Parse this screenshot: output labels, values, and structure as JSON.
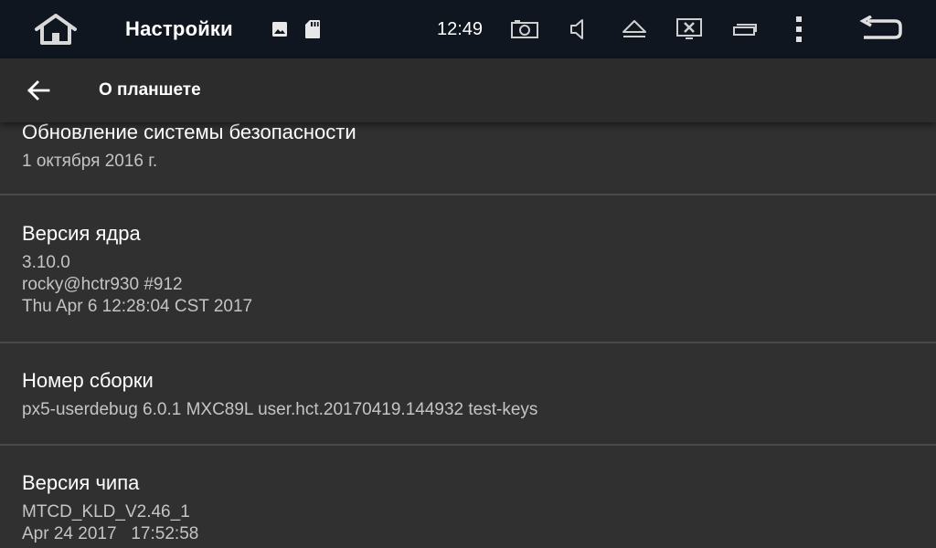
{
  "statusbar": {
    "title": "Настройки",
    "time": "12:49",
    "icons": [
      "home-icon",
      "gallery-icon",
      "sd-card-icon",
      "screenshot-icon",
      "volume-icon",
      "eject-icon",
      "close-screen-icon",
      "windows-icon",
      "more-vert-icon",
      "back-icon"
    ]
  },
  "toolbar": {
    "title": "О планшете",
    "back_icon": "arrow-back-icon"
  },
  "preferences": [
    {
      "title": "Обновление системы безопасности",
      "summary": "1 октября 2016 г."
    },
    {
      "title": "Версия ядра",
      "summary": "3.10.0\nrocky@hctr930 #912\nThu Apr 6 12:28:04 CST 2017"
    },
    {
      "title": "Номер сборки",
      "summary": "px5-userdebug 6.0.1 MXC89L user.hct.20170419.144932 test-keys"
    },
    {
      "title": "Версия чипа",
      "summary": "MTCD_KLD_V2.46_1\nApr 24 2017   17:52:58"
    }
  ],
  "colors": {
    "statusbar_bg": "#0f1620",
    "toolbar_bg": "#2c2c2c",
    "content_bg": "#303030",
    "divider": "#4a4a4a",
    "summary_text": "#c4c4c4"
  }
}
